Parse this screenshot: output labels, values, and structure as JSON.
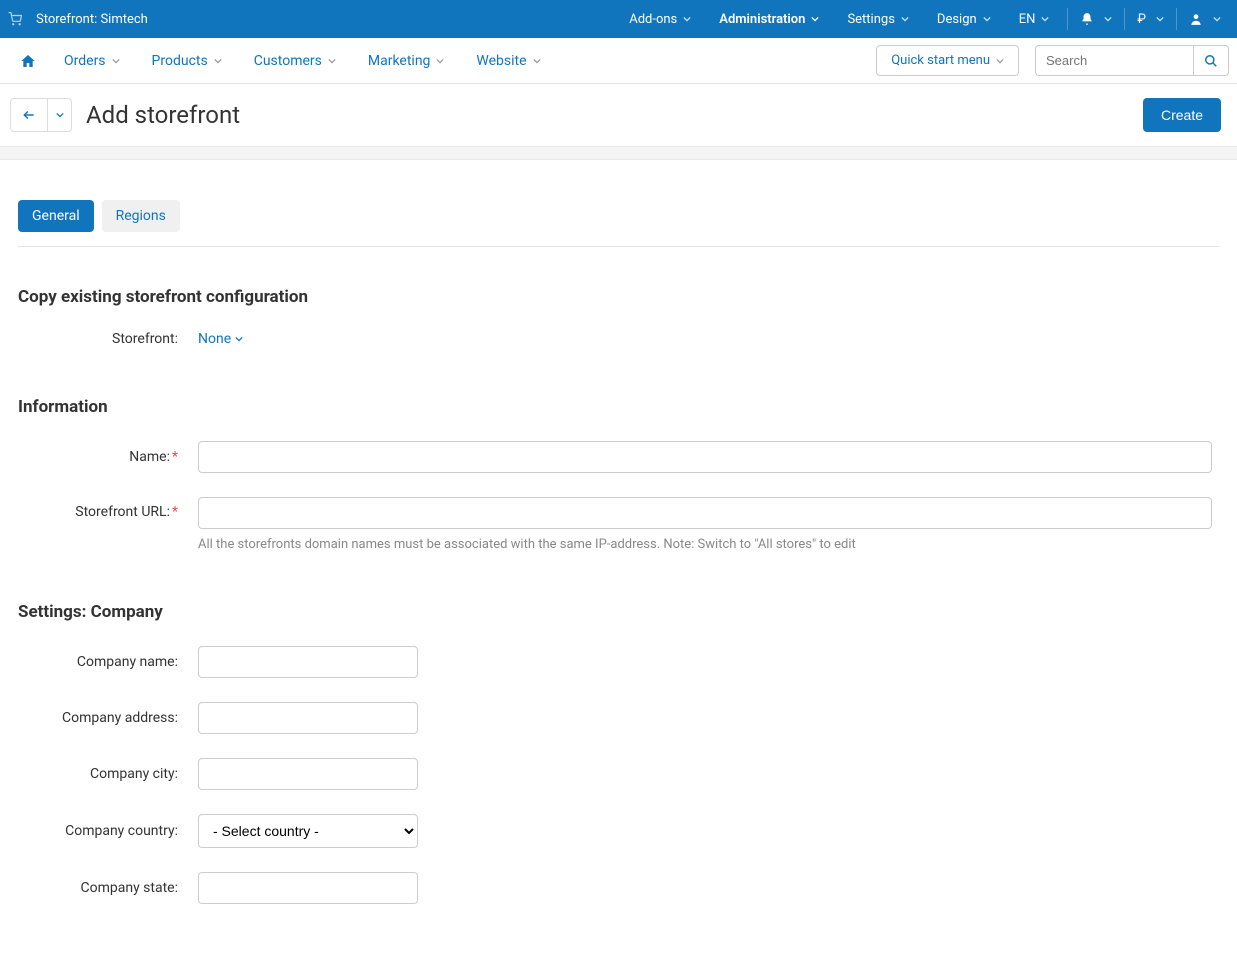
{
  "topbar": {
    "storefront_label": "Storefront: Simtech",
    "nav": {
      "addons": "Add-ons",
      "administration": "Administration",
      "settings": "Settings",
      "design": "Design",
      "language": "EN",
      "currency": "₽"
    }
  },
  "menubar": {
    "orders": "Orders",
    "products": "Products",
    "customers": "Customers",
    "marketing": "Marketing",
    "website": "Website",
    "quick_start": "Quick start menu",
    "search_placeholder": "Search"
  },
  "page": {
    "title": "Add storefront",
    "create_button": "Create"
  },
  "tabs": {
    "general": "General",
    "regions": "Regions"
  },
  "sections": {
    "copy_existing": {
      "heading": "Copy existing storefront configuration",
      "storefront_label": "Storefront:",
      "storefront_value": "None"
    },
    "information": {
      "heading": "Information",
      "name_label": "Name:",
      "name_value": "",
      "url_label": "Storefront URL:",
      "url_value": "",
      "url_help": "All the storefronts domain names must be associated with the same IP-address. Note: Switch to \"All stores\" to edit"
    },
    "company": {
      "heading": "Settings: Company",
      "name_label": "Company name:",
      "name_value": "",
      "address_label": "Company address:",
      "address_value": "",
      "city_label": "Company city:",
      "city_value": "",
      "country_label": "Company country:",
      "country_value": "- Select country -",
      "state_label": "Company state:",
      "state_value": ""
    }
  }
}
